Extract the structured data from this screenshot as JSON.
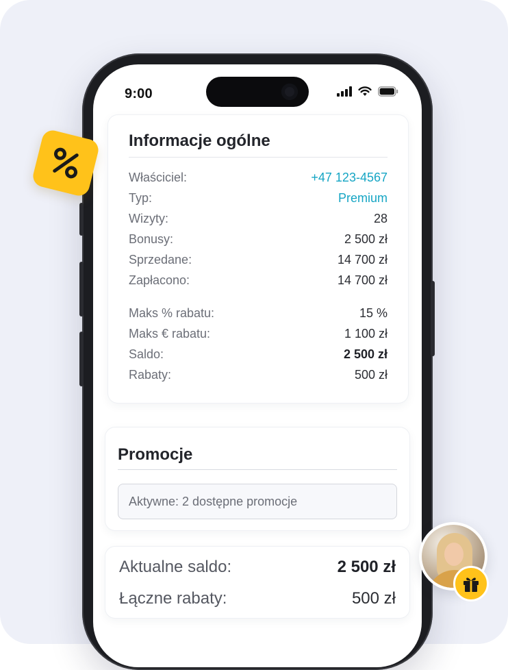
{
  "status_bar": {
    "time": "9:00",
    "icons": [
      "signal-icon",
      "wifi-icon",
      "battery-icon"
    ]
  },
  "info_card": {
    "title": "Informacje ogólne",
    "rows": [
      {
        "label": "Właściciel:",
        "value": "+47 123-4567"
      },
      {
        "label": "Typ:",
        "value": "Premium"
      },
      {
        "label": "Wizyty:",
        "value": "28"
      },
      {
        "label": "Bonusy:",
        "value": "2 500 zł"
      },
      {
        "label": "Sprzedane:",
        "value": "14 700 zł"
      },
      {
        "label": "Zapłacono:",
        "value": "14 700 zł"
      }
    ],
    "rows2": [
      {
        "label": "Maks % rabatu:",
        "value": "15 %"
      },
      {
        "label": "Maks € rabatu:",
        "value": "1 100 zł"
      },
      {
        "label": "Saldo:",
        "value": "2 500 zł"
      },
      {
        "label": "Rabaty:",
        "value": "500 zł"
      }
    ]
  },
  "promo_card": {
    "title": "Promocje",
    "field_value": "Aktywne: 2 dostępne promocje"
  },
  "summary": {
    "balance_label": "Aktualne saldo:",
    "balance_value": "2 500 zł",
    "discounts_label": "Łączne rabaty:",
    "discounts_value": "500 zł"
  },
  "colors": {
    "accent_link": "#15a5c4",
    "badge_yellow": "#ffc21a",
    "background": "#eef0f8"
  },
  "badges": {
    "percent_icon": "percent-icon",
    "gift_icon": "gift-icon"
  }
}
